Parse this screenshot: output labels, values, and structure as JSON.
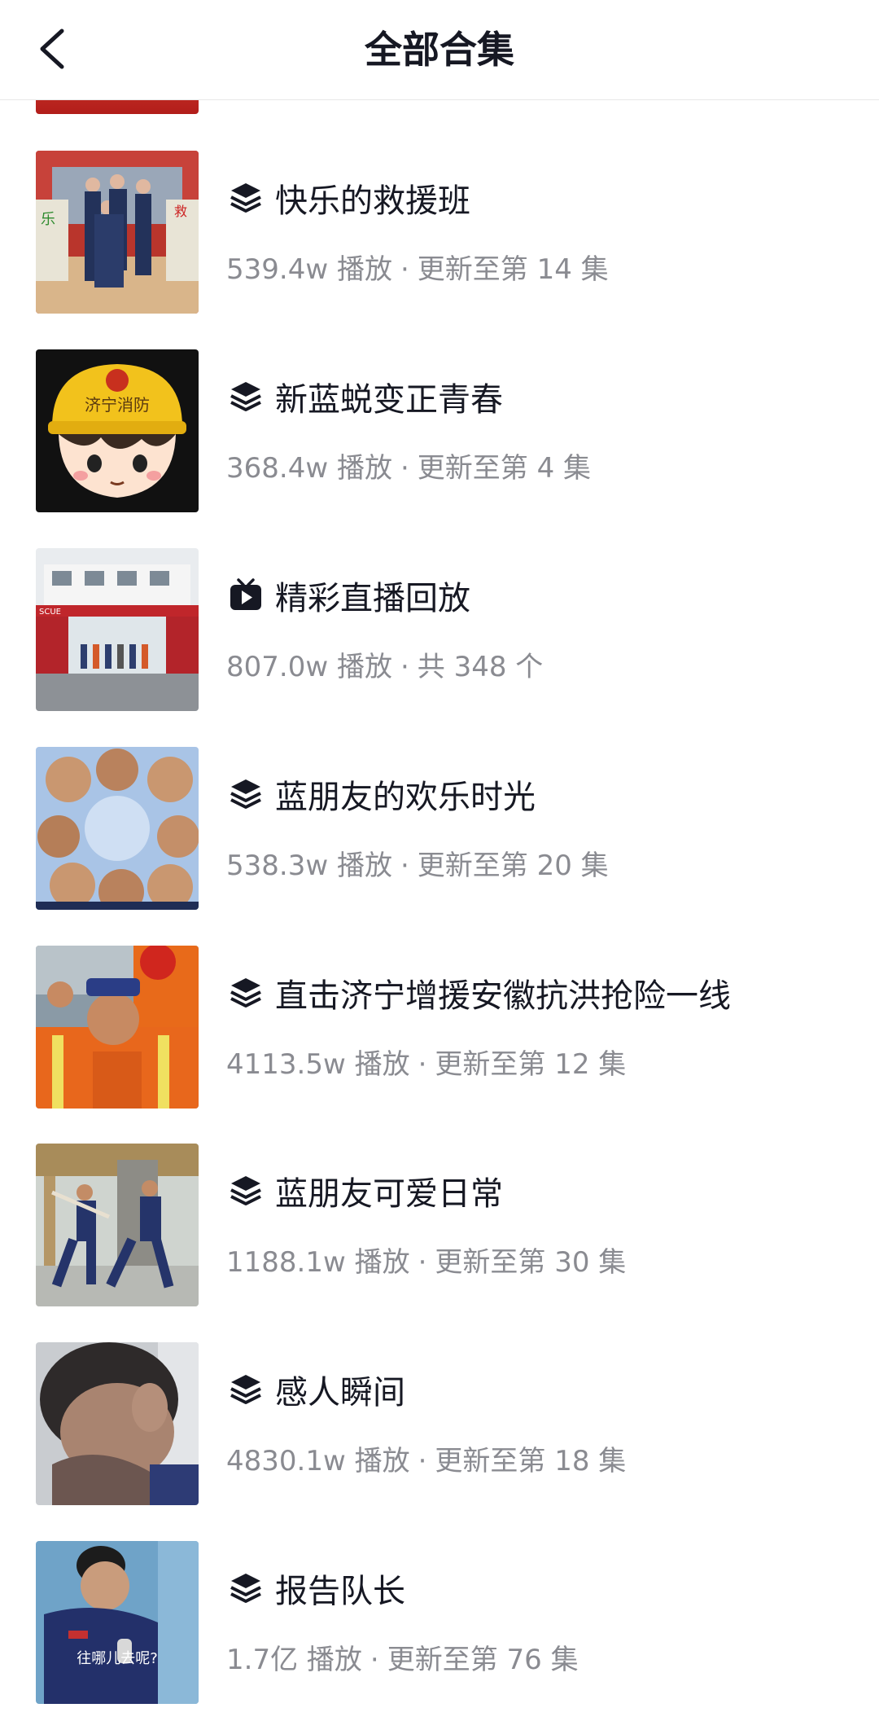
{
  "header": {
    "title": "全部合集",
    "back_icon": "chevron-left-icon"
  },
  "collections": [
    {
      "title": "快乐的救援班",
      "icon": "stack-icon",
      "plays": "539.4w 播放",
      "update": "更新至第 14 集"
    },
    {
      "title": "新蓝蜕变正青春",
      "icon": "stack-icon",
      "plays": "368.4w 播放",
      "update": "更新至第 4 集"
    },
    {
      "title": "精彩直播回放",
      "icon": "tv-icon",
      "plays": "807.0w 播放",
      "update": "共 348 个"
    },
    {
      "title": "蓝朋友的欢乐时光",
      "icon": "stack-icon",
      "plays": "538.3w 播放",
      "update": "更新至第 20 集"
    },
    {
      "title": "直击济宁增援安徽抗洪抢险一线",
      "icon": "stack-icon",
      "plays": "4113.5w 播放",
      "update": "更新至第 12 集"
    },
    {
      "title": "蓝朋友可爱日常",
      "icon": "stack-icon",
      "plays": "1188.1w 播放",
      "update": "更新至第 30 集"
    },
    {
      "title": "感人瞬间",
      "icon": "stack-icon",
      "plays": "4830.1w 播放",
      "update": "更新至第 18 集"
    },
    {
      "title": "报告队长",
      "icon": "stack-icon",
      "plays": "1.7亿 播放",
      "update": "更新至第 76 集"
    }
  ],
  "thumb_texts": {
    "helmet": "济宁消防",
    "rescue": "SCUE",
    "caption": "往哪儿去呢?"
  },
  "colors": {
    "text_primary": "#161823",
    "text_secondary": "#8a8b91",
    "divider": "#e8e8e8"
  }
}
